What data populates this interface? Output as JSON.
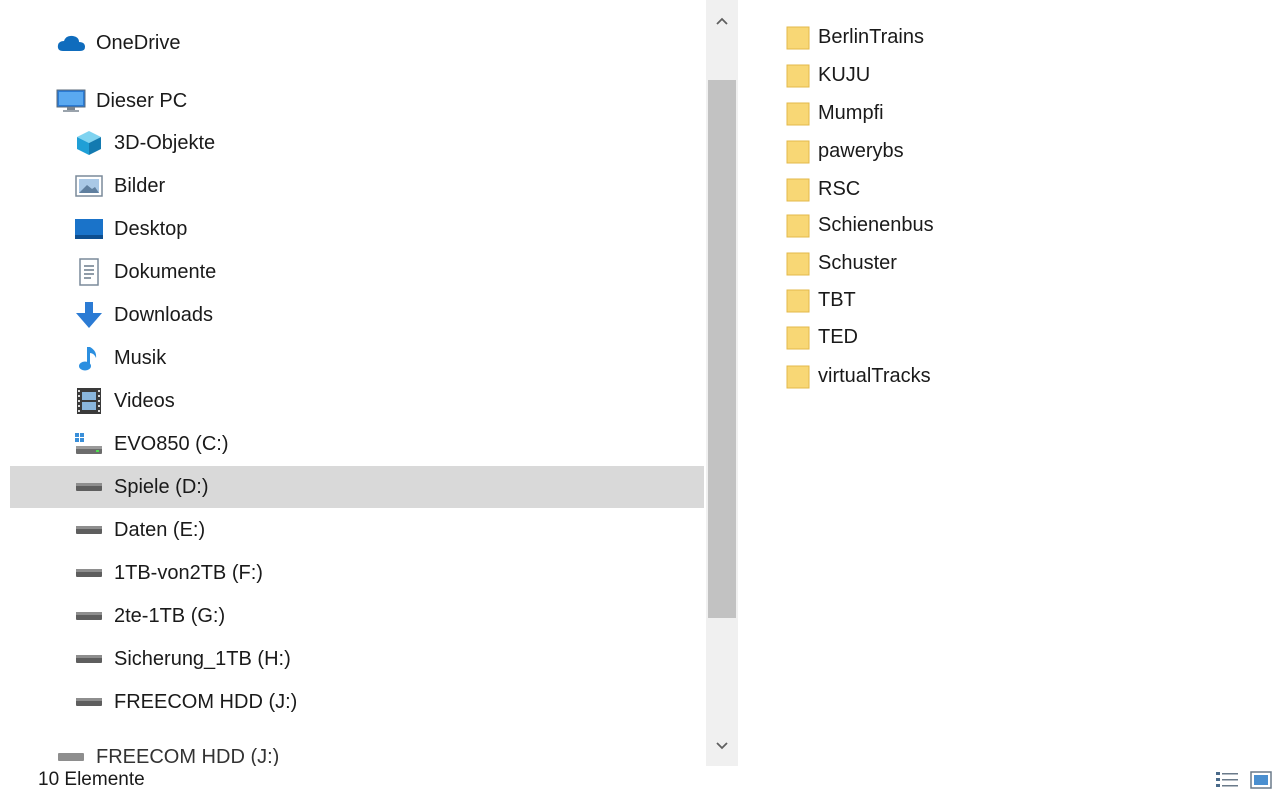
{
  "nav": {
    "onedrive": "OneDrive",
    "this_pc": "Dieser PC",
    "items": [
      {
        "label": "3D-Objekte",
        "icon": "3d-objects-icon"
      },
      {
        "label": "Bilder",
        "icon": "pictures-icon"
      },
      {
        "label": "Desktop",
        "icon": "desktop-icon"
      },
      {
        "label": "Dokumente",
        "icon": "documents-icon"
      },
      {
        "label": "Downloads",
        "icon": "download-arrow-icon"
      },
      {
        "label": "Musik",
        "icon": "music-note-icon"
      },
      {
        "label": "Videos",
        "icon": "film-icon"
      },
      {
        "label": "EVO850 (C:)",
        "icon": "system-drive-icon"
      },
      {
        "label": "Spiele (D:)",
        "icon": "drive-icon",
        "selected": true
      },
      {
        "label": "Daten (E:)",
        "icon": "drive-icon"
      },
      {
        "label": "1TB-von2TB (F:)",
        "icon": "drive-icon"
      },
      {
        "label": "2te-1TB (G:)",
        "icon": "drive-icon"
      },
      {
        "label": "Sicherung_1TB (H:)",
        "icon": "drive-icon"
      },
      {
        "label": "FREECOM HDD (J:)",
        "icon": "drive-icon"
      }
    ],
    "cut_item": "FREECOM HDD (J:)"
  },
  "files": [
    {
      "name": "BerlinTrains"
    },
    {
      "name": "KUJU"
    },
    {
      "name": "Mumpfi"
    },
    {
      "name": "pawerybs"
    },
    {
      "name": "RSC"
    },
    {
      "name": "Schienenbus"
    },
    {
      "name": "Schuster"
    },
    {
      "name": "TBT"
    },
    {
      "name": "TED"
    },
    {
      "name": "virtualTracks"
    }
  ],
  "status": {
    "count_text": "10 Elemente"
  },
  "colors": {
    "selection": "#d9d9d9",
    "folder": "#f8d775",
    "scrollbar_track": "#f0f0f0",
    "scrollbar_thumb": "#c2c2c2"
  }
}
